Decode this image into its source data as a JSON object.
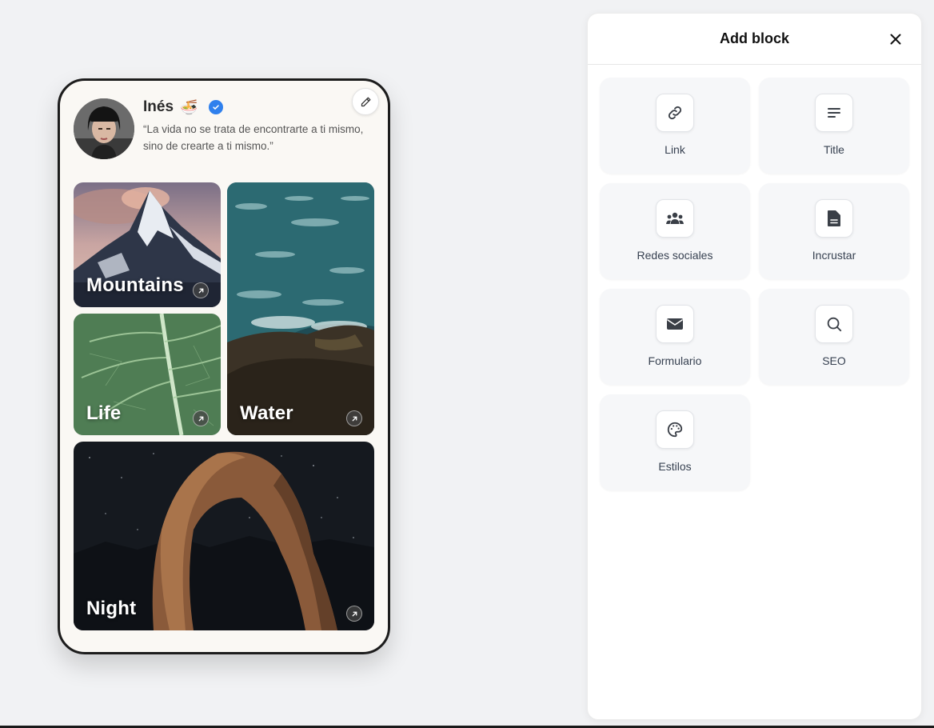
{
  "profile": {
    "name": "Inés",
    "name_emoji": "🍜",
    "bio": "“La vida no se trata de encontrarte a ti mismo, sino de crearte a ti mismo.”"
  },
  "tiles": [
    {
      "label": "Mountains"
    },
    {
      "label": "Water"
    },
    {
      "label": "Life"
    },
    {
      "label": "Night"
    }
  ],
  "panel": {
    "title": "Add block",
    "blocks": [
      {
        "label": "Link",
        "icon": "link-icon"
      },
      {
        "label": "Title",
        "icon": "title-lines-icon"
      },
      {
        "label": "Redes sociales",
        "icon": "people-icon"
      },
      {
        "label": "Incrustar",
        "icon": "document-icon"
      },
      {
        "label": "Formulario",
        "icon": "envelope-icon"
      },
      {
        "label": "SEO",
        "icon": "search-icon"
      },
      {
        "label": "Estilos",
        "icon": "palette-icon"
      }
    ]
  },
  "colors": {
    "background": "#f1f2f4",
    "phone_bg": "#faf8f4",
    "verified": "#2f80ed",
    "card_bg": "#f6f7f9"
  }
}
